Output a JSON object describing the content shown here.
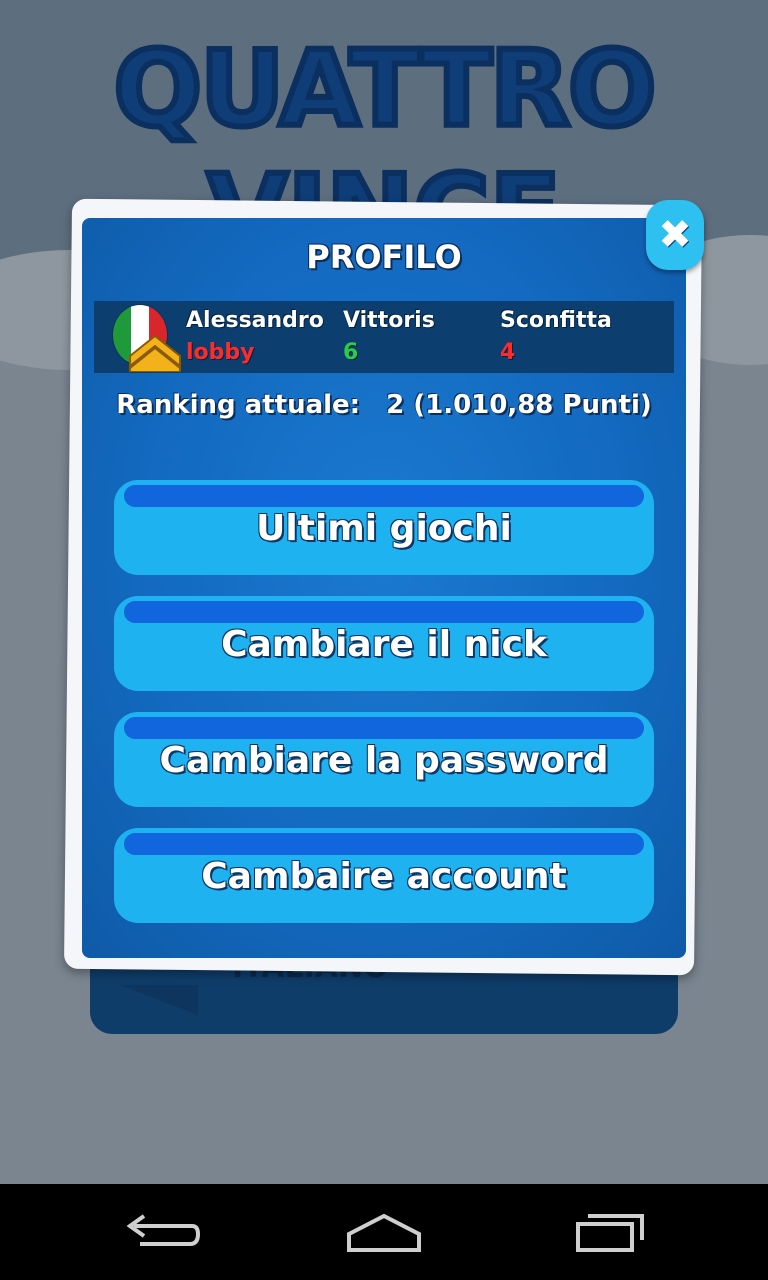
{
  "background": {
    "title_line1": "QUATTRO",
    "title_line2": "VINCE",
    "panel_text": "ITALIANO"
  },
  "dialog": {
    "title": "PROFILO",
    "close_icon": "close-icon"
  },
  "player": {
    "name": "Alessandro",
    "status": "lobby",
    "wins_label": "Vittoris",
    "wins_value": "6",
    "losses_label": "Sconfitta",
    "losses_value": "4",
    "flag": "italy-flag-icon",
    "rank_badge": "sergeant-chevron-icon"
  },
  "ranking": {
    "label": "Ranking attuale:",
    "value": "2 (1.010,88 Punti)"
  },
  "buttons": [
    {
      "label": "Ultimi giochi"
    },
    {
      "label": "Cambiare il nick"
    },
    {
      "label": "Cambiare la password"
    },
    {
      "label": "Cambaire account"
    }
  ],
  "colors": {
    "status": "#ff2a2a",
    "wins": "#2ecc40",
    "losses": "#ff2a2a",
    "dialog_blue": "#136ac0",
    "button_blue": "#1fb2f0"
  },
  "navbar": {
    "back": "back-icon",
    "home": "home-icon",
    "recents": "recent-apps-icon"
  }
}
